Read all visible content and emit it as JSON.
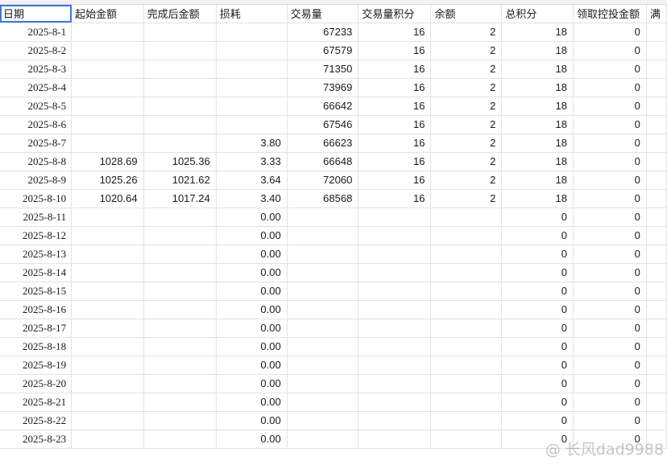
{
  "headers": [
    "日期",
    "起始金额",
    "完成后金额",
    "损耗",
    "交易量",
    "交易量积分",
    "余额",
    "总积分",
    "领取控投金额",
    "满"
  ],
  "rows": [
    [
      "2025-8-1",
      "",
      "",
      "",
      "67233",
      "16",
      "2",
      "18",
      "0"
    ],
    [
      "2025-8-2",
      "",
      "",
      "",
      "67579",
      "16",
      "2",
      "18",
      "0"
    ],
    [
      "2025-8-3",
      "",
      "",
      "",
      "71350",
      "16",
      "2",
      "18",
      "0"
    ],
    [
      "2025-8-4",
      "",
      "",
      "",
      "73969",
      "16",
      "2",
      "18",
      "0"
    ],
    [
      "2025-8-5",
      "",
      "",
      "",
      "66642",
      "16",
      "2",
      "18",
      "0"
    ],
    [
      "2025-8-6",
      "",
      "",
      "",
      "67546",
      "16",
      "2",
      "18",
      "0"
    ],
    [
      "2025-8-7",
      "",
      "",
      "3.80",
      "66623",
      "16",
      "2",
      "18",
      "0"
    ],
    [
      "2025-8-8",
      "1028.69",
      "1025.36",
      "3.33",
      "66648",
      "16",
      "2",
      "18",
      "0"
    ],
    [
      "2025-8-9",
      "1025.26",
      "1021.62",
      "3.64",
      "72060",
      "16",
      "2",
      "18",
      "0"
    ],
    [
      "2025-8-10",
      "1020.64",
      "1017.24",
      "3.40",
      "68568",
      "16",
      "2",
      "18",
      "0"
    ],
    [
      "2025-8-11",
      "",
      "",
      "0.00",
      "",
      "",
      "",
      "0",
      "0"
    ],
    [
      "2025-8-12",
      "",
      "",
      "0.00",
      "",
      "",
      "",
      "0",
      "0"
    ],
    [
      "2025-8-13",
      "",
      "",
      "0.00",
      "",
      "",
      "",
      "0",
      "0"
    ],
    [
      "2025-8-14",
      "",
      "",
      "0.00",
      "",
      "",
      "",
      "0",
      "0"
    ],
    [
      "2025-8-15",
      "",
      "",
      "0.00",
      "",
      "",
      "",
      "0",
      "0"
    ],
    [
      "2025-8-16",
      "",
      "",
      "0.00",
      "",
      "",
      "",
      "0",
      "0"
    ],
    [
      "2025-8-17",
      "",
      "",
      "0.00",
      "",
      "",
      "",
      "0",
      "0"
    ],
    [
      "2025-8-18",
      "",
      "",
      "0.00",
      "",
      "",
      "",
      "0",
      "0"
    ],
    [
      "2025-8-19",
      "",
      "",
      "0.00",
      "",
      "",
      "",
      "0",
      "0"
    ],
    [
      "2025-8-20",
      "",
      "",
      "0.00",
      "",
      "",
      "",
      "0",
      "0"
    ],
    [
      "2025-8-21",
      "",
      "",
      "0.00",
      "",
      "",
      "",
      "0",
      "0"
    ],
    [
      "2025-8-22",
      "",
      "",
      "0.00",
      "",
      "",
      "",
      "0",
      "0"
    ],
    [
      "2025-8-23",
      "",
      "",
      "0.00",
      "",
      "",
      "",
      "0",
      "0"
    ]
  ],
  "watermark": "@ 长风dad9988",
  "colors": {
    "selection": "#3a78e0",
    "grid": "#e2e2e2"
  }
}
